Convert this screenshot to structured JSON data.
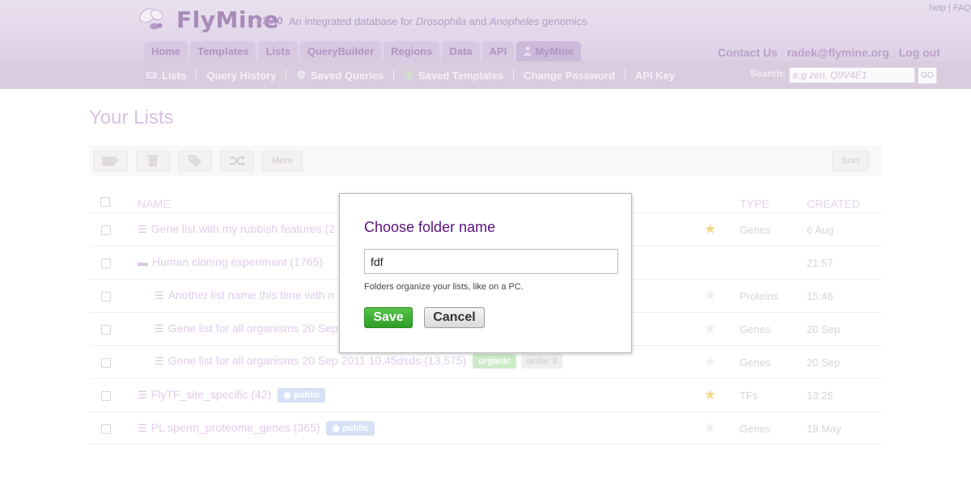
{
  "header": {
    "brand": "FlyMine",
    "version": "v30.0",
    "tagline_prefix": "An integrated database for",
    "tagline_species1": "Drosophila",
    "tagline_and": "and",
    "tagline_species2": "Anopheles",
    "tagline_suffix": "genomics",
    "help": "help",
    "faq": "FAQ",
    "tabs": [
      {
        "label": "Home"
      },
      {
        "label": "Templates"
      },
      {
        "label": "Lists"
      },
      {
        "label": "QueryBuilder"
      },
      {
        "label": "Regions"
      },
      {
        "label": "Data"
      },
      {
        "label": "API"
      },
      {
        "label": "MyMine",
        "icon": "person-icon"
      }
    ],
    "contact": "Contact Us",
    "user_email": "radek@flymine.org",
    "logout": "Log out"
  },
  "subnav": {
    "items": [
      {
        "label": "Lists",
        "icon": "list-icon"
      },
      {
        "label": "Query History"
      },
      {
        "label": "Saved Queries",
        "icon": "gear-icon"
      },
      {
        "label": "Saved Templates",
        "icon": "gear-icon"
      },
      {
        "label": "Change Password"
      },
      {
        "label": "API Key"
      }
    ],
    "search_label": "Search:",
    "search_placeholder": "e.g zen, Q9V4E1",
    "go": "GO"
  },
  "page": {
    "title": "Your Lists",
    "toolbar": {
      "more": "More",
      "sort": "Sort"
    },
    "columns": {
      "name": "NAME",
      "type": "TYPE",
      "created": "CREATED"
    },
    "rows": [
      {
        "name": "Gene list with my rubbish features (2",
        "type": "Genes",
        "created": "6 Aug",
        "starred": true,
        "kind": "list"
      },
      {
        "name": "Human cloning experiment (1765)",
        "type": "",
        "created": "21:57",
        "starred": false,
        "kind": "folder"
      },
      {
        "name": "Another list name this time with n",
        "type": "Proteins",
        "created": "15:46",
        "starred": false,
        "kind": "list"
      },
      {
        "name": "Gene list for all organisms 20 Sep",
        "type": "Genes",
        "created": "20 Sep",
        "starred": false,
        "kind": "list"
      },
      {
        "name": "Gene list for all organisms 20 Sep 2011 10.45dsds (13,575)",
        "type": "Genes",
        "created": "20 Sep",
        "starred": false,
        "kind": "list",
        "tags": [
          "organic",
          "order 3"
        ]
      },
      {
        "name": "FlyTF_site_specific (42)",
        "type": "TFs",
        "created": "13:25",
        "starred": true,
        "kind": "list",
        "public": "public"
      },
      {
        "name": "PL sperm_proteome_genes (365)",
        "type": "Genes",
        "created": "19 May",
        "starred": false,
        "kind": "list",
        "public": "public"
      }
    ]
  },
  "modal": {
    "title": "Choose folder name",
    "input_value": "fdf",
    "hint": "Folders organize your lists, like on a PC.",
    "save": "Save",
    "cancel": "Cancel"
  },
  "colors": {
    "modal_title": "#5a1278",
    "save_green": "#2e9e27",
    "star_gold": "#f0d88a"
  }
}
